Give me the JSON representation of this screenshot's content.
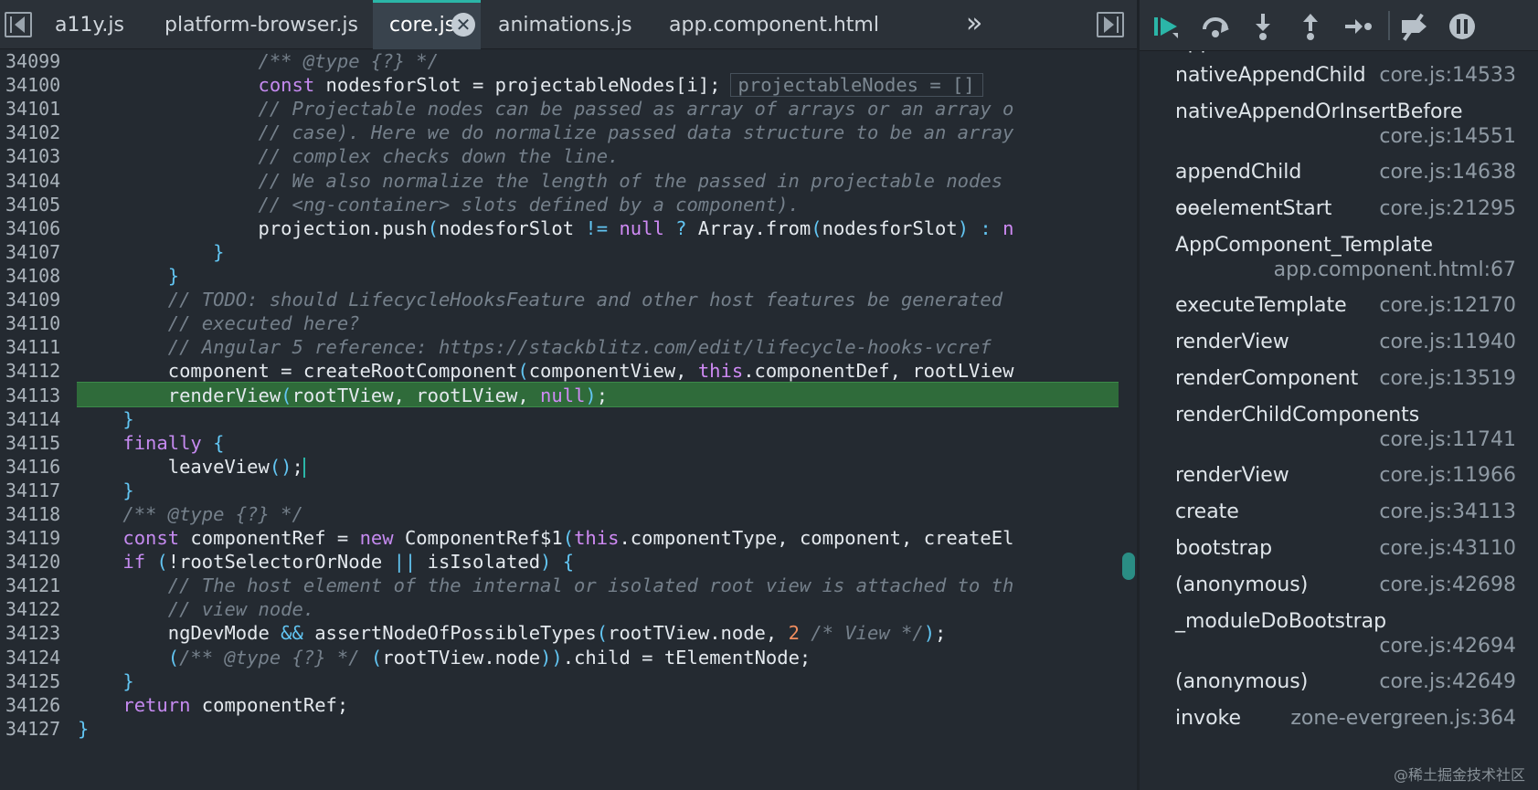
{
  "tabs": [
    {
      "label": "a11y.js",
      "active": false
    },
    {
      "label": "platform-browser.js",
      "active": false
    },
    {
      "label": "core.js",
      "active": true
    },
    {
      "label": "animations.js",
      "active": false
    },
    {
      "label": "app.component.html",
      "active": false
    }
  ],
  "tab_close_glyph": "✕",
  "tab_overflow_glyph": "»",
  "editor": {
    "execution_line": "34113",
    "lines": [
      {
        "n": "34099",
        "tokens": [
          [
            "cm",
            "                /** @type {?} */"
          ]
        ]
      },
      {
        "n": "34100",
        "tokens": [
          [
            "pl",
            "                "
          ],
          [
            "kw",
            "const"
          ],
          [
            "pl",
            " nodesforSlot = projectableNodes[i];"
          ],
          [
            "iv",
            "projectableNodes = []"
          ]
        ]
      },
      {
        "n": "34101",
        "tokens": [
          [
            "cm",
            "                // Projectable nodes can be passed as array of arrays or an array o"
          ]
        ]
      },
      {
        "n": "34102",
        "tokens": [
          [
            "cm",
            "                // case). Here we do normalize passed data structure to be an array"
          ]
        ]
      },
      {
        "n": "34103",
        "tokens": [
          [
            "cm",
            "                // complex checks down the line."
          ]
        ]
      },
      {
        "n": "34104",
        "tokens": [
          [
            "cm",
            "                // We also normalize the length of the passed in projectable nodes"
          ]
        ]
      },
      {
        "n": "34105",
        "tokens": [
          [
            "cm",
            "                // <ng-container> slots defined by a component)."
          ]
        ]
      },
      {
        "n": "34106",
        "tokens": [
          [
            "pl",
            "                projection.push"
          ],
          [
            "op",
            "("
          ],
          [
            "pl",
            "nodesforSlot "
          ],
          [
            "op",
            "!="
          ],
          [
            "pl",
            " "
          ],
          [
            "null",
            "null"
          ],
          [
            "pl",
            " "
          ],
          [
            "op",
            "?"
          ],
          [
            "pl",
            " Array.from"
          ],
          [
            "op",
            "("
          ],
          [
            "pl",
            "nodesforSlot"
          ],
          [
            "op",
            ")"
          ],
          [
            "pl",
            " "
          ],
          [
            "op",
            ":"
          ],
          [
            "pl",
            " "
          ],
          [
            "null",
            "n"
          ]
        ]
      },
      {
        "n": "34107",
        "tokens": [
          [
            "pl",
            "            "
          ],
          [
            "op",
            "}"
          ]
        ]
      },
      {
        "n": "34108",
        "tokens": [
          [
            "pl",
            "        "
          ],
          [
            "op",
            "}"
          ]
        ]
      },
      {
        "n": "34109",
        "tokens": [
          [
            "cm",
            "        // TODO: should LifecycleHooksFeature and other host features be generated"
          ]
        ]
      },
      {
        "n": "34110",
        "tokens": [
          [
            "cm",
            "        // executed here?"
          ]
        ]
      },
      {
        "n": "34111",
        "tokens": [
          [
            "cm",
            "        // Angular 5 reference: https://stackblitz.com/edit/lifecycle-hooks-vcref"
          ]
        ]
      },
      {
        "n": "34112",
        "tokens": [
          [
            "pl",
            "        component = createRootComponent"
          ],
          [
            "op",
            "("
          ],
          [
            "pl",
            "componentView, "
          ],
          [
            "this",
            "this"
          ],
          [
            "pl",
            ".componentDef, rootLView"
          ]
        ]
      },
      {
        "n": "34113",
        "tokens": [
          [
            "pl",
            "        renderView"
          ],
          [
            "op",
            "("
          ],
          [
            "pl",
            "rootTView, rootLView, "
          ],
          [
            "null",
            "null"
          ],
          [
            "op",
            ")"
          ],
          [
            "pl",
            ";"
          ]
        ]
      },
      {
        "n": "34114",
        "tokens": [
          [
            "pl",
            "    "
          ],
          [
            "op",
            "}"
          ]
        ]
      },
      {
        "n": "34115",
        "tokens": [
          [
            "pl",
            "    "
          ],
          [
            "kw",
            "finally"
          ],
          [
            "pl",
            " "
          ],
          [
            "op",
            "{"
          ]
        ]
      },
      {
        "n": "34116",
        "tokens": [
          [
            "pl",
            "        leaveView"
          ],
          [
            "op",
            "()"
          ],
          [
            "pl",
            ";"
          ],
          [
            "cursor",
            ""
          ]
        ]
      },
      {
        "n": "34117",
        "tokens": [
          [
            "pl",
            "    "
          ],
          [
            "op",
            "}"
          ]
        ]
      },
      {
        "n": "34118",
        "tokens": [
          [
            "cm",
            "    /** @type {?} */"
          ]
        ]
      },
      {
        "n": "34119",
        "tokens": [
          [
            "pl",
            "    "
          ],
          [
            "kw",
            "const"
          ],
          [
            "pl",
            " componentRef = "
          ],
          [
            "kw",
            "new"
          ],
          [
            "pl",
            " ComponentRef$1"
          ],
          [
            "op",
            "("
          ],
          [
            "this",
            "this"
          ],
          [
            "pl",
            ".componentType, component, createEl"
          ]
        ]
      },
      {
        "n": "34120",
        "tokens": [
          [
            "pl",
            "    "
          ],
          [
            "kw",
            "if"
          ],
          [
            "pl",
            " "
          ],
          [
            "op",
            "("
          ],
          [
            "pl",
            "!rootSelectorOrNode "
          ],
          [
            "op",
            "||"
          ],
          [
            "pl",
            " isIsolated"
          ],
          [
            "op",
            ")"
          ],
          [
            "pl",
            " "
          ],
          [
            "op",
            "{"
          ]
        ]
      },
      {
        "n": "34121",
        "tokens": [
          [
            "cm",
            "        // The host element of the internal or isolated root view is attached to th"
          ]
        ]
      },
      {
        "n": "34122",
        "tokens": [
          [
            "cm",
            "        // view node."
          ]
        ]
      },
      {
        "n": "34123",
        "tokens": [
          [
            "pl",
            "        ngDevMode "
          ],
          [
            "op",
            "&&"
          ],
          [
            "pl",
            " assertNodeOfPossibleTypes"
          ],
          [
            "op",
            "("
          ],
          [
            "pl",
            "rootTView.node, "
          ],
          [
            "num",
            "2"
          ],
          [
            "pl",
            " "
          ],
          [
            "cm",
            "/* View */"
          ],
          [
            "op",
            ")"
          ],
          [
            "pl",
            ";"
          ]
        ]
      },
      {
        "n": "34124",
        "tokens": [
          [
            "pl",
            "        "
          ],
          [
            "op",
            "("
          ],
          [
            "cm",
            "/** @type {?} */"
          ],
          [
            "pl",
            " "
          ],
          [
            "op",
            "("
          ],
          [
            "pl",
            "rootTView.node"
          ],
          [
            "op",
            "))"
          ],
          [
            "pl",
            ".child = tElementNode;"
          ]
        ]
      },
      {
        "n": "34125",
        "tokens": [
          [
            "pl",
            "    "
          ],
          [
            "op",
            "}"
          ]
        ]
      },
      {
        "n": "34126",
        "tokens": [
          [
            "pl",
            "    "
          ],
          [
            "kw",
            "return"
          ],
          [
            "pl",
            " componentRef;"
          ]
        ]
      },
      {
        "n": "34127",
        "tokens": [
          [
            "op",
            "}"
          ]
        ]
      }
    ]
  },
  "debug_toolbar": {
    "accent": "#2bb6a8",
    "buttons": [
      "resume-icon",
      "step-over-icon",
      "step-into-icon",
      "step-out-icon",
      "step-icon",
      "deactivate-breakpoints-icon",
      "pause-on-exceptions-icon"
    ]
  },
  "callstack": {
    "frames": [
      {
        "name": "nativeAppendChild",
        "location": "core.js:14533",
        "wrap": false
      },
      {
        "name": "nativeAppendOrInsertBefore",
        "location": "core.js:14551",
        "wrap": true
      },
      {
        "name": "appendChild",
        "location": "core.js:14638",
        "wrap": false
      },
      {
        "name": "ɵɵelementStart",
        "location": "core.js:21295",
        "wrap": false
      },
      {
        "name": "AppComponent_Template",
        "location": "app.component.html:67",
        "wrap": true
      },
      {
        "name": "executeTemplate",
        "location": "core.js:12170",
        "wrap": false
      },
      {
        "name": "renderView",
        "location": "core.js:11940",
        "wrap": false
      },
      {
        "name": "renderComponent",
        "location": "core.js:13519",
        "wrap": false
      },
      {
        "name": "renderChildComponents",
        "location": "core.js:11741",
        "wrap": true
      },
      {
        "name": "renderView",
        "location": "core.js:11966",
        "wrap": false
      },
      {
        "name": "create",
        "location": "core.js:34113",
        "wrap": false
      },
      {
        "name": "bootstrap",
        "location": "core.js:43110",
        "wrap": false
      },
      {
        "name": "(anonymous)",
        "location": "core.js:42698",
        "wrap": false
      },
      {
        "name": "_moduleDoBootstrap",
        "location": "core.js:42694",
        "wrap": true
      },
      {
        "name": "(anonymous)",
        "location": "core.js:42649",
        "wrap": false
      },
      {
        "name": "invoke",
        "location": "zone-evergreen.js:364",
        "wrap": false
      }
    ]
  },
  "watermark": "@稀土掘金技术社区"
}
